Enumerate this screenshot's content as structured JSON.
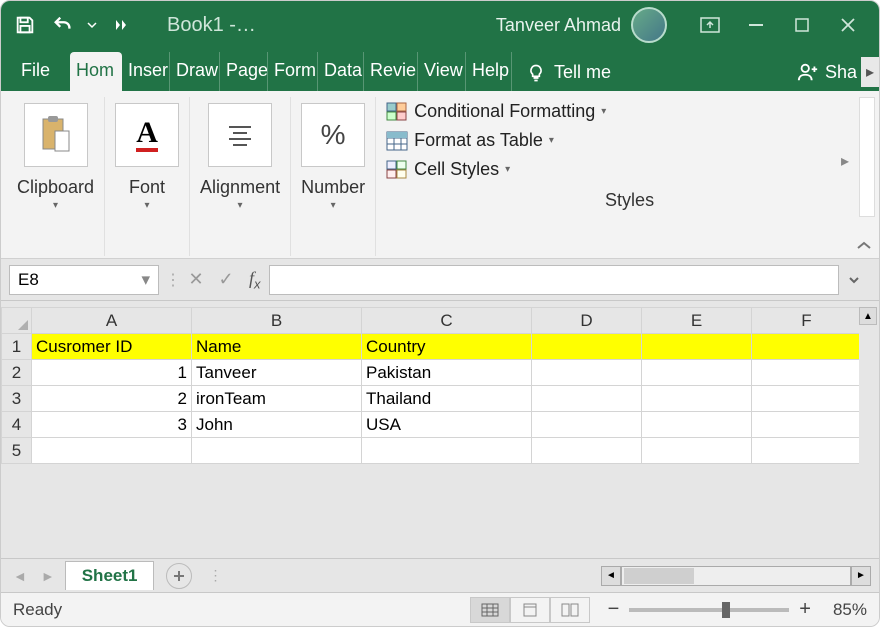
{
  "title": {
    "document": "Book1  -…",
    "username": "Tanveer Ahmad"
  },
  "tabs": {
    "file": "File",
    "list": [
      "Home",
      "Insert",
      "Draw",
      "Page",
      "Form",
      "Data",
      "Review",
      "View",
      "Help"
    ],
    "display": [
      "Hom",
      "Inser",
      "Draw",
      "Page",
      "Form",
      "Data",
      "Revie",
      "View",
      "Help"
    ],
    "tellme": "Tell me",
    "share": "Sha"
  },
  "ribbon": {
    "clipboard": "Clipboard",
    "font": "Font",
    "alignment": "Alignment",
    "number": "Number",
    "number_symbol": "%",
    "styles": {
      "cond": "Conditional Formatting",
      "table": "Format as Table",
      "cell": "Cell Styles",
      "label": "Styles"
    }
  },
  "formula": {
    "namebox": "E8",
    "value": ""
  },
  "chart_data": {
    "type": "table",
    "columns": [
      "Cusromer ID",
      "Name",
      "Country"
    ],
    "rows": [
      {
        "id": 1,
        "name": "Tanveer",
        "country": "Pakistan"
      },
      {
        "id": 2,
        "name": "ironTeam",
        "country": "Thailand"
      },
      {
        "id": 3,
        "name": "John",
        "country": "USA"
      }
    ]
  },
  "grid": {
    "col_letters": [
      "A",
      "B",
      "C",
      "D",
      "E",
      "F"
    ],
    "row_numbers": [
      "1",
      "2",
      "3",
      "4",
      "5"
    ]
  },
  "sheets": {
    "active": "Sheet1"
  },
  "status": {
    "text": "Ready",
    "zoom": "85%"
  }
}
